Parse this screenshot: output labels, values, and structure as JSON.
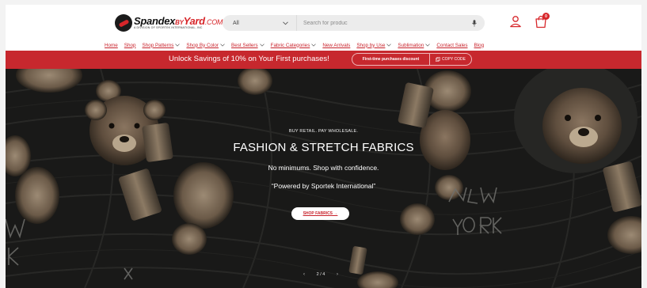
{
  "header": {
    "logo": {
      "brand_main": "Spandex",
      "brand_by": "BY",
      "brand_yard": "Yard",
      "brand_com": ".COM",
      "subline": "A DIVISION OF SPORTEK INTERNATIONAL, INC"
    },
    "search": {
      "category_value": "All",
      "placeholder": "Search for produc"
    },
    "cart": {
      "count": "0"
    },
    "icons": {
      "account": "account-icon",
      "cart": "cart-icon",
      "mic": "mic-icon",
      "chevron": "chevron-down-icon"
    }
  },
  "nav": {
    "items": [
      {
        "label": "Home",
        "dropdown": false
      },
      {
        "label": "Shop",
        "dropdown": false
      },
      {
        "label": "Shop Patterns",
        "dropdown": true
      },
      {
        "label": "Shop By Color",
        "dropdown": true
      },
      {
        "label": "Best Sellers",
        "dropdown": true
      },
      {
        "label": "Fabric Categories",
        "dropdown": true
      },
      {
        "label": "New Arrivals",
        "dropdown": false
      },
      {
        "label": "Shop by Use",
        "dropdown": true
      },
      {
        "label": "Sublimation",
        "dropdown": true
      },
      {
        "label": "Contact Sales",
        "dropdown": false
      },
      {
        "label": "Blog",
        "dropdown": false
      }
    ]
  },
  "promo": {
    "text": "Unlock Savings of 10% on Your First purchases!",
    "code_label": "First-time purchases discount",
    "copy_label": "COPY CODE"
  },
  "hero": {
    "eyebrow": "BUY RETAIL. PAY WHOLESALE.",
    "headline": "FASHION & STRETCH FABRICS",
    "tagline": "No minimums. Shop with confidence.",
    "powered": "“Powered by Sportek International”",
    "cta_label": "SHOP FABRICS →",
    "slider": {
      "prev": "‹",
      "count": "2 / 4",
      "next": "›"
    }
  },
  "colors": {
    "brand_red": "#c7282e",
    "hero_bg": "#181817",
    "link": "#c8232c"
  }
}
